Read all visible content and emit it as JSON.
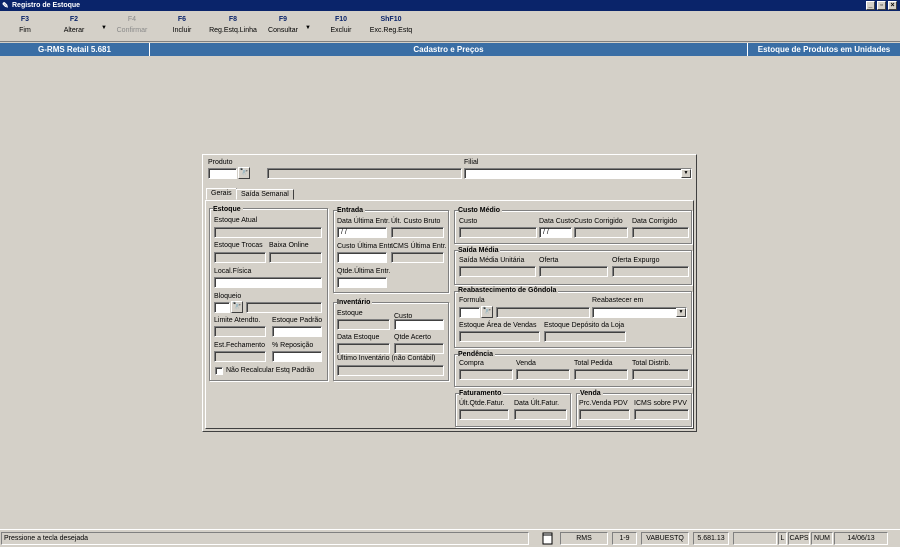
{
  "window": {
    "title": "Registro de Estoque",
    "icon": "app-icon",
    "buttons": [
      "_",
      "▫",
      "×"
    ]
  },
  "toolbar": [
    {
      "key": "F3",
      "label": "Fim",
      "enabled": true
    },
    {
      "key": "F2",
      "label": "Alterar",
      "enabled": true
    },
    {
      "key": "F4",
      "label": "Confirmar",
      "enabled": false
    },
    {
      "key": "F6",
      "label": "Incluir",
      "enabled": true
    },
    {
      "key": "F8",
      "label": "Reg.Estq.Linha",
      "enabled": true
    },
    {
      "key": "F9",
      "label": "Consultar",
      "enabled": true
    },
    {
      "key": "F10",
      "label": "Excluir",
      "enabled": true
    },
    {
      "key": "ShF10",
      "label": "Exc.Reg.Estq",
      "enabled": true
    }
  ],
  "infobar": {
    "app": "G-RMS Retail 5.681",
    "module": "Cadastro e Preços",
    "screen": "Estoque de Produtos em Unidades",
    "color": "#3a6ea5"
  },
  "header": {
    "produto_label": "Produto",
    "filial_label": "Filial"
  },
  "tabs": [
    {
      "label": "Gerais",
      "active": true
    },
    {
      "label": "Saída Semanal",
      "active": false
    }
  ],
  "estoque": {
    "title": "Estoque",
    "atual": "Estoque Atual",
    "trocas": "Estoque Trocas",
    "baixa_online": "Baixa Online",
    "local_fisica": "Local.Física",
    "bloqueio": "Bloqueio",
    "limite_atendto": "Limite Atendto.",
    "estoque_padrao": "Estoque Padrão",
    "est_fechamento": "Est.Fechamento",
    "pct_reposicao": "% Reposição",
    "nao_recalcular": "Não Recalcular Estq Padrão"
  },
  "entrada": {
    "title": "Entrada",
    "data_ultima": "Data Última Entr.",
    "data_value": " / /",
    "ult_custo_bruto": "Últ. Custo Bruto",
    "custo_ultima": "Custo Última Entr.",
    "icms_ultima": "ICMS Última Entr.",
    "qtde_ultima": "Qtde.Última Entr."
  },
  "inventario": {
    "title": "Inventário",
    "estoque": "Estoque",
    "custo": "Custo",
    "data_estoque": "Data Estoque",
    "qtde_acerto": "Qtde Acerto",
    "ultimo": "Último Inventário (não Contábil)"
  },
  "custo_medio": {
    "title": "Custo Médio",
    "custo": "Custo",
    "data_custo": "Data Custo",
    "data_value": " / /",
    "custo_corrigido": "Custo Corrigido",
    "data_corrigido": "Data Corrigido"
  },
  "saida_media": {
    "title": "Saída Média",
    "unitaria": "Saída Média Unitária",
    "oferta": "Oferta",
    "oferta_expurgo": "Oferta Expurgo"
  },
  "reabastecimento": {
    "title": "Reabastecimento de Gôndola",
    "formula": "Formula",
    "reabastecer_em": "Reabastecer em",
    "area_vendas": "Estoque Área de Vendas",
    "deposito_loja": "Estoque Depósito da Loja"
  },
  "pendencia": {
    "title": "Pendência",
    "compra": "Compra",
    "venda": "Venda",
    "total_pedida": "Total Pedida",
    "total_distrib": "Total  Distrib."
  },
  "faturamento": {
    "title": "Faturamento",
    "ult_qtde": "Últ.Qtde.Fatur.",
    "data_ult": "Data Últ.Fatur."
  },
  "venda": {
    "title": "Venda",
    "prc_pdv": "Prc.Venda PDV",
    "icms_pvv": "ICMS sobre PVV"
  },
  "statusbar": {
    "message": "Pressione a tecla desejada",
    "system": "RMS",
    "page": "1-9",
    "user": "VABUESTQ",
    "version": "5.681.13",
    "blank": "",
    "l": "L",
    "caps": "CAPS",
    "num": "NUM",
    "date": "14/06/13"
  }
}
